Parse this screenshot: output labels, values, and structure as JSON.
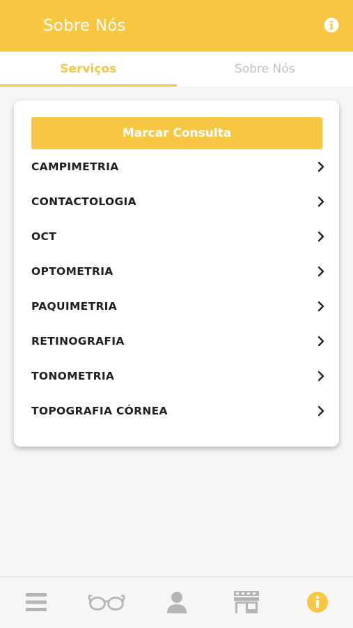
{
  "header": {
    "title": "Sobre Nós",
    "info_icon": "info-circle-icon",
    "background_color": "#f7c744"
  },
  "tabs": [
    {
      "label": "Serviços",
      "active": true
    },
    {
      "label": "Sobre Nós",
      "active": false
    }
  ],
  "card": {
    "cta_label": "Marcar Consulta",
    "items": [
      {
        "label": "CAMPIMETRIA"
      },
      {
        "label": "CONTACTOLOGIA"
      },
      {
        "label": "OCT"
      },
      {
        "label": "OPTOMETRIA"
      },
      {
        "label": "PAQUIMETRIA"
      },
      {
        "label": "RETINOGRAFIA"
      },
      {
        "label": "TONOMETRIA"
      },
      {
        "label": "TOPOGRAFIA CÓRNEA"
      }
    ]
  },
  "bottom_nav": {
    "items": [
      {
        "icon": "menu-icon",
        "active": false
      },
      {
        "icon": "glasses-icon",
        "active": false
      },
      {
        "icon": "user-icon",
        "active": false
      },
      {
        "icon": "store-icon",
        "active": false
      },
      {
        "icon": "info-icon",
        "active": true
      }
    ],
    "active_color": "#f7c744",
    "inactive_color": "#b5b5b5"
  }
}
